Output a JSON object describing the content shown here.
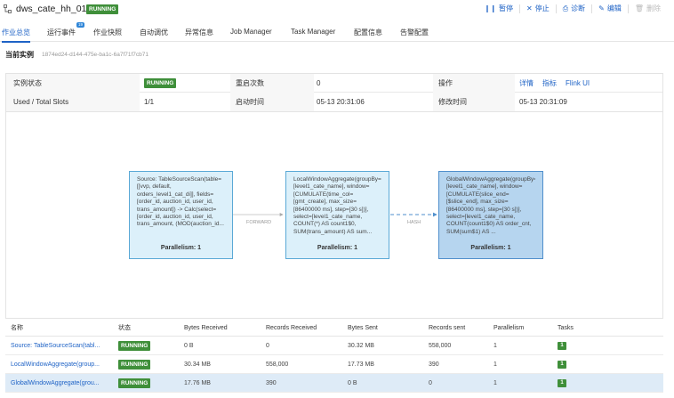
{
  "header": {
    "job_name": "dws_cate_hh_01",
    "status": "RUNNING",
    "actions": {
      "pause": "暂停",
      "stop": "停止",
      "diagnose": "诊断",
      "edit": "编辑",
      "delete": "删除"
    }
  },
  "tabs": [
    {
      "label": "作业总览",
      "active": true
    },
    {
      "label": "运行事件",
      "badge": "19"
    },
    {
      "label": "作业快照"
    },
    {
      "label": "自动调优"
    },
    {
      "label": "异常信息"
    },
    {
      "label": "Job Manager"
    },
    {
      "label": "Task Manager"
    },
    {
      "label": "配置信息"
    },
    {
      "label": "告警配置"
    }
  ],
  "instance": {
    "label": "当前实例",
    "id": "1874ed24-d144-475e-ba1c-6a7f71f7cb71"
  },
  "info": {
    "instance_status_label": "实例状态",
    "instance_status": "RUNNING",
    "restart_label": "重启次数",
    "restart_count": "0",
    "operation_label": "操作",
    "operation_links": {
      "detail": "详情",
      "metrics": "指标",
      "flink_ui": "Flink UI"
    },
    "slots_label": "Used / Total Slots",
    "slots_value": "1/1",
    "start_time_label": "启动时间",
    "start_time": "05-13 20:31:06",
    "modify_time_label": "修改时间",
    "modify_time": "05-13 20:31:09"
  },
  "graph": {
    "nodes": [
      {
        "description": "Source: TableSourceScan(table=[[vvp, default, orders_level1_cat_di]], fields=[order_id, auction_id, user_id, trans_amount]) -> Calc(select=[order_id, auction_id, user_id, trans_amount, (MOD(auction_id...",
        "parallelism": "Parallelism: 1"
      },
      {
        "description": "LocalWindowAggregate(groupBy=[level1_cate_name], window=[CUMULATE(time_col=[gmt_create], max_size=[86400000 ms], step=[30 s])], select=[level1_cate_name, COUNT(*) AS count1$0, SUM(trans_amount) AS sum...",
        "parallelism": "Parallelism: 1"
      },
      {
        "description": "GlobalWindowAggregate(groupBy=[level1_cate_name], window=[CUMULATE(slice_end=[$slice_end], max_size=[86400000 ms], step=[30 s])], select=[level1_cate_name, COUNT(count1$0) AS order_cnt, SUM(sum$1) AS ...",
        "parallelism": "Parallelism: 1"
      }
    ],
    "edges": [
      "FORWARD",
      "HASH"
    ]
  },
  "table": {
    "columns": [
      "名称",
      "状态",
      "Bytes Received",
      "Records Received",
      "Bytes Sent",
      "Records sent",
      "Parallelism",
      "Tasks"
    ],
    "rows": [
      {
        "name": "Source: TableSourceScan(tabl...",
        "status": "RUNNING",
        "bytes_received": "0 B",
        "records_received": "0",
        "bytes_sent": "30.32 MB",
        "records_sent": "558,000",
        "parallelism": "1",
        "tasks": "1"
      },
      {
        "name": "LocalWindowAggregate(group...",
        "status": "RUNNING",
        "bytes_received": "30.34 MB",
        "records_received": "558,000",
        "bytes_sent": "17.73 MB",
        "records_sent": "390",
        "parallelism": "1",
        "tasks": "1"
      },
      {
        "name": "GlobalWindowAggregate(grou...",
        "status": "RUNNING",
        "bytes_received": "17.76 MB",
        "records_received": "390",
        "bytes_sent": "0 B",
        "records_sent": "0",
        "parallelism": "1",
        "tasks": "1"
      }
    ]
  },
  "colors": {
    "accent": "#1f63c6",
    "running": "#3f8f3a",
    "node_fill": "#dcf0fa",
    "node_selected_fill": "#b6d5ef",
    "row_selected": "#deebf7"
  }
}
